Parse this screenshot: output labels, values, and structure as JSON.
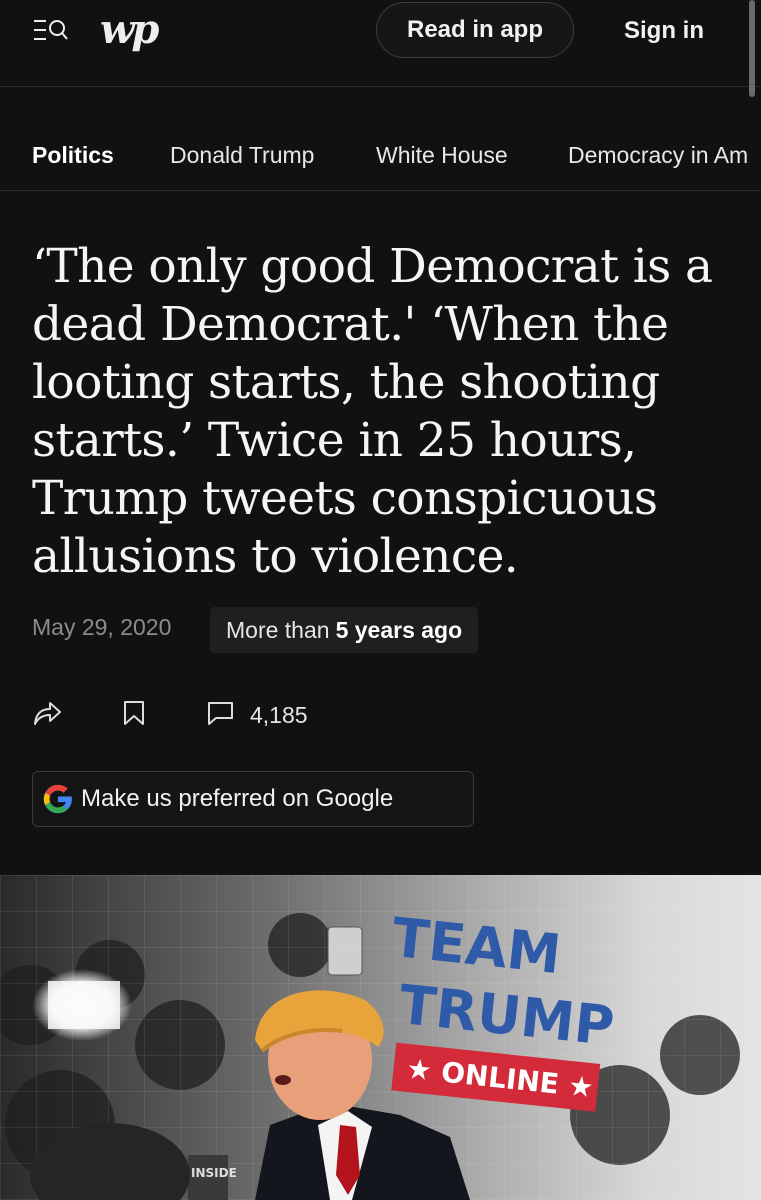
{
  "topbar": {
    "read_in_app": "Read in app",
    "sign_in": "Sign in",
    "logo": "wp"
  },
  "nav": {
    "items": [
      {
        "label": "Politics",
        "active": true
      },
      {
        "label": "Donald Trump"
      },
      {
        "label": "White House"
      },
      {
        "label": "Democracy in Am"
      }
    ]
  },
  "article": {
    "headline": "‘The only good Democrat is a dead Democrat.' ‘When the looting starts, the shooting starts.’ Twice in 25 hours, Trump tweets conspicuous allusions to violence.",
    "date": "May 29, 2020",
    "age_prefix": "More than",
    "age_bold": "5 years ago",
    "comment_count": "4,185"
  },
  "google": {
    "label": "Make us preferred on Google"
  },
  "hero": {
    "sign_line1": "TEAM",
    "sign_line2": "TRUMP",
    "sign_line3": "★ ONLINE ★",
    "mic_flag": "INSIDE"
  },
  "colors": {
    "background": "#111111",
    "sign_red": "#d32b3a",
    "sign_blue": "#2f5aa8"
  }
}
